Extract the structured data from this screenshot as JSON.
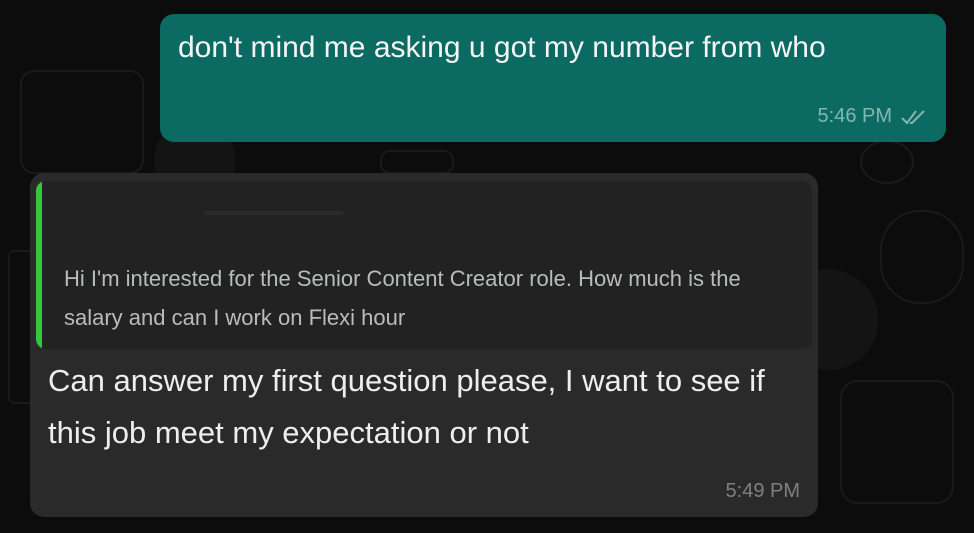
{
  "conversation": {
    "outgoing": {
      "text": "don't mind me asking u got my number from who",
      "time": "5:46 PM",
      "status_icon": "double-check-icon",
      "status": "read"
    },
    "incoming": {
      "quoted": {
        "text": "Hi I'm interested for the Senior Content Creator role. How much is the salary and can I work on Flexi hour",
        "bar_color": "#32c83a"
      },
      "text": "Can answer my first question please, I want to see if this job meet my expectation or not",
      "time": "5:49 PM"
    }
  },
  "colors": {
    "background": "#0c0c0c",
    "outgoing_bubble": "#0b6a62",
    "incoming_bubble": "#2a2a2a",
    "quote_bar": "#32c83a"
  }
}
